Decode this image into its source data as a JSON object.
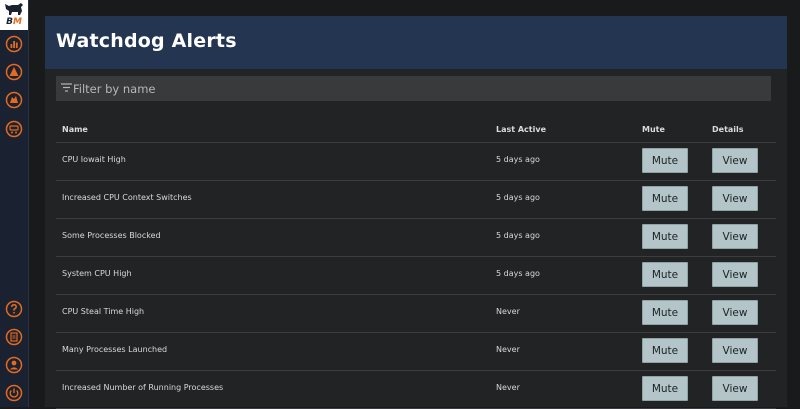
{
  "app": {
    "logo_text_b": "B",
    "logo_text_m": "M",
    "brand_color": "#e36a1e",
    "sidebar_color": "#1a2130",
    "header_color": "#243551"
  },
  "sidebar": {
    "top_icons": [
      "dashboard-icon",
      "alert-icon",
      "watchdog-icon",
      "network-icon"
    ],
    "bottom_icons": [
      "help-icon",
      "documents-icon",
      "user-icon",
      "power-icon"
    ]
  },
  "page": {
    "title": "Watchdog Alerts",
    "filter_placeholder": "Filter by name"
  },
  "table": {
    "headers": {
      "name": "Name",
      "last_active": "Last Active",
      "mute": "Mute",
      "details": "Details"
    },
    "rows": [
      {
        "name": "CPU Iowait High",
        "last_active": "5 days ago",
        "mute_label": "Mute",
        "view_label": "View"
      },
      {
        "name": "Increased CPU Context Switches",
        "last_active": "5 days ago",
        "mute_label": "Mute",
        "view_label": "View"
      },
      {
        "name": "Some Processes Blocked",
        "last_active": "5 days ago",
        "mute_label": "Mute",
        "view_label": "View"
      },
      {
        "name": "System CPU High",
        "last_active": "5 days ago",
        "mute_label": "Mute",
        "view_label": "View"
      },
      {
        "name": "CPU Steal Time High",
        "last_active": "Never",
        "mute_label": "Mute",
        "view_label": "View"
      },
      {
        "name": "Many Processes Launched",
        "last_active": "Never",
        "mute_label": "Mute",
        "view_label": "View"
      },
      {
        "name": "Increased Number of Running Processes",
        "last_active": "Never",
        "mute_label": "Mute",
        "view_label": "View"
      }
    ]
  }
}
